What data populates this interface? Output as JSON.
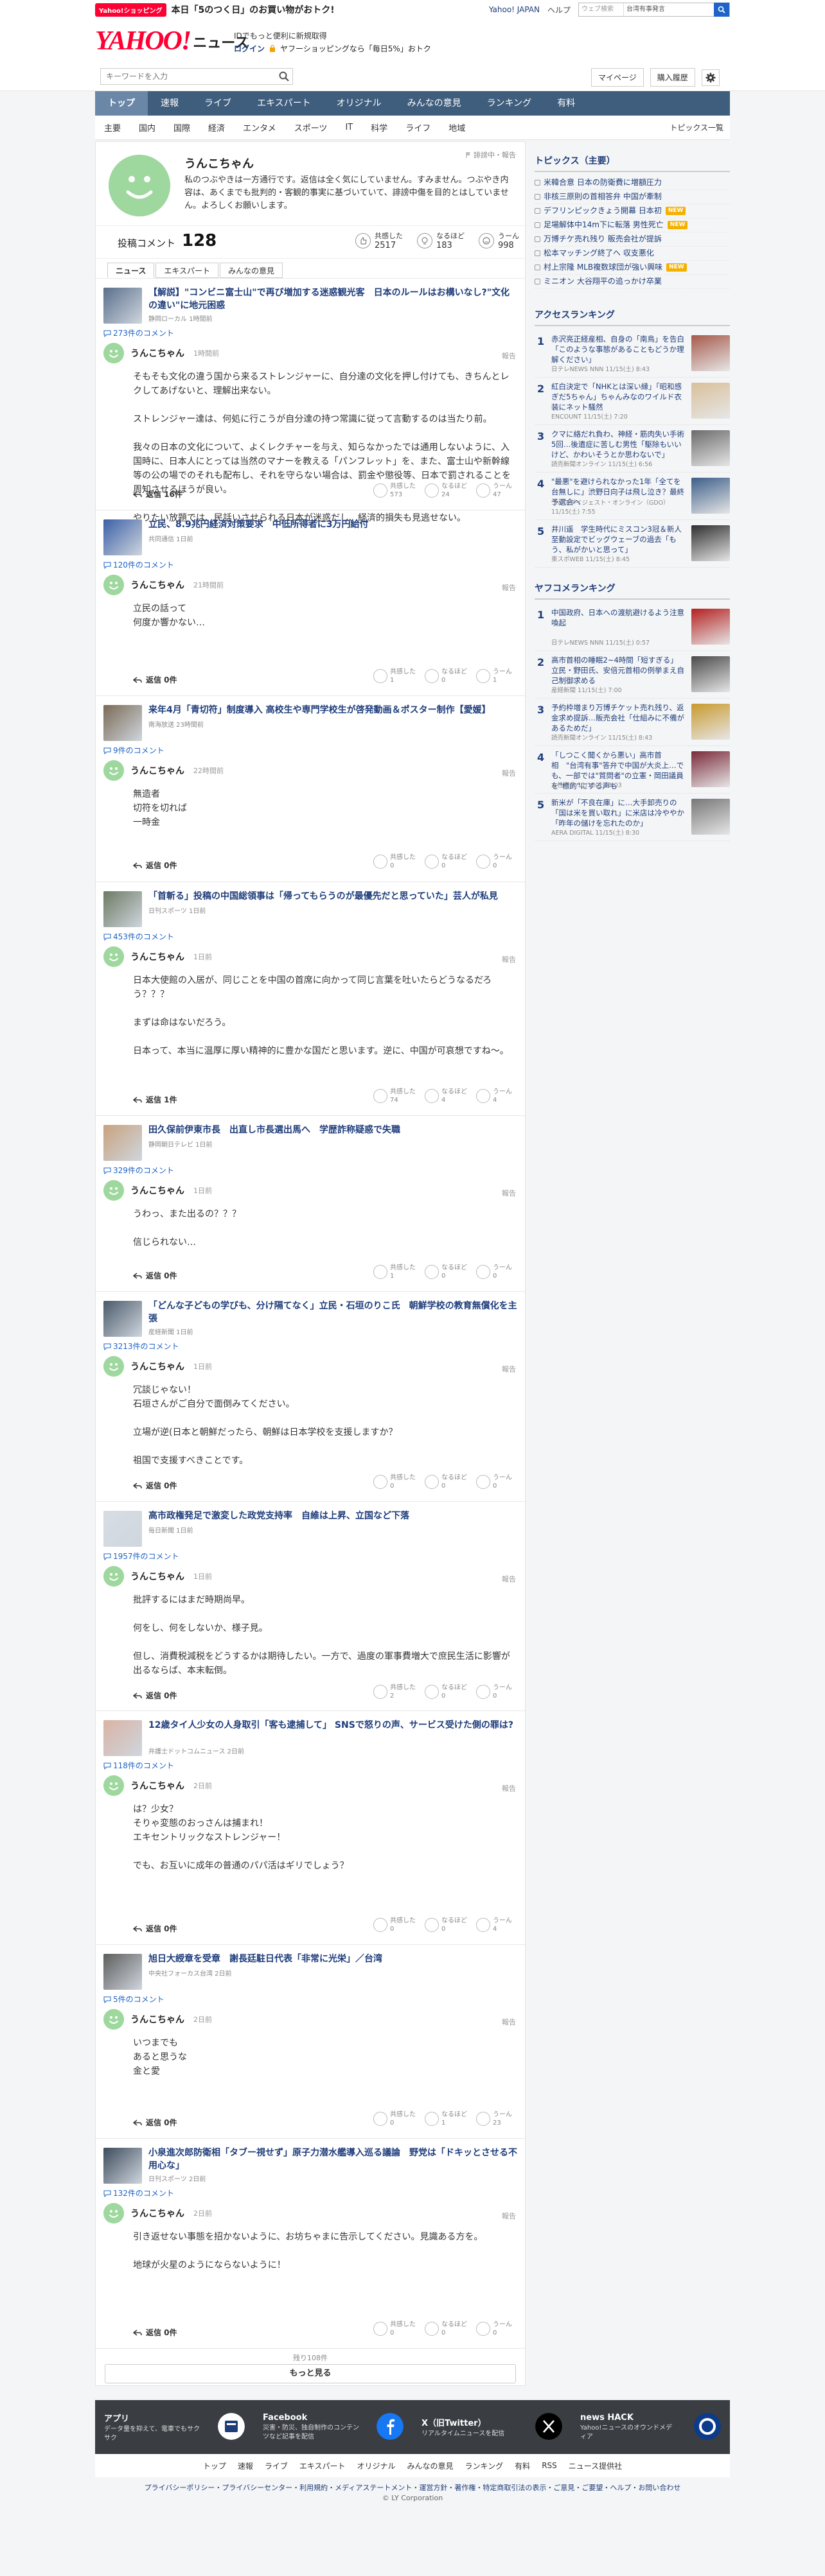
{
  "top": {
    "badge": "Yahoo!ショッピング",
    "promo": "本日「5のつく日」のお買い物がおトク!",
    "links": [
      "Yahoo! JAPAN",
      "ヘルプ"
    ],
    "search_scope": "ウェブ検索",
    "search_query": "台湾有事発言"
  },
  "header": {
    "logo_y": "YAHOO!",
    "logo_news": "ニュース",
    "id_line": "IDでもっと便利に新規取得",
    "login": "ログイン",
    "promo": "ヤフーショッピングなら「毎日5%」おトク"
  },
  "search": {
    "placeholder": "キーワードを入力",
    "mypage": "マイページ",
    "purchase": "購入履歴"
  },
  "nav": [
    "トップ",
    "速報",
    "ライブ",
    "エキスパート",
    "オリジナル",
    "みんなの意見",
    "ランキング",
    "有料"
  ],
  "subnav": [
    "主要",
    "国内",
    "国際",
    "経済",
    "エンタメ",
    "スポーツ",
    "IT",
    "科学",
    "ライフ",
    "地域"
  ],
  "subnav_all": "トピックス一覧",
  "profile": {
    "name": "うんこちゃん",
    "bio": "私のつぶやきは一方通行です。返信は全く気にしていません。すみません。つぶやき内容は、あくまでも批判的・客観的事実に基づいていて、誹謗中傷を目的とはしていません。よろしくお願いします。",
    "report": "誹謗中・報告",
    "posts_label": "投稿コメント",
    "posts_count": "128",
    "reacts": [
      {
        "label": "共感した",
        "value": "2517"
      },
      {
        "label": "なるほど",
        "value": "183"
      },
      {
        "label": "うーん",
        "value": "998"
      }
    ]
  },
  "tabs": [
    "ニュース",
    "エキスパート",
    "みんなの意見"
  ],
  "items": [
    {
      "title": "【解説】\"コンビニ富士山\"で再び増加する迷惑観光客　日本のルールはお構いなし?\"文化の違い\"に地元困惑",
      "source": "静岡ローカル 1時間前",
      "count": "273件のコメント",
      "name": "うんこちゃん",
      "time": "1時間前",
      "report": "報告",
      "body": [
        "そもそも文化の違う国から来るストレンジャーに、自分達の文化を押し付けても、きちんとレクしてあげないと、理解出来ない。",
        "ストレンジャー達は、何処に行こうが自分達の持つ常識に従って言動するのは当たり前。",
        "我々の日本の文化について、よくレクチャーを与え、知らなかったでは通用しないように、入国時に、日本人にとっては当然のマナーを教える「パンフレット」を、また、富士山や新幹線等の公の場でのそれも配布し、それを守らない場合は、罰金や懲役等、日本で罰されることを周知させるほうが良い。",
        "やりたい放題では、民話いさせられる日本が迷惑だし、経済的損失も見逃せない。"
      ],
      "reply": "返信 16件",
      "r": [
        "573",
        "24",
        "47"
      ]
    },
    {
      "title": "立民、8.9兆円経済対策要求　中低所得者に3万円給付",
      "source": "共同通信 1日前",
      "count": "120件のコメント",
      "name": "うんこちゃん",
      "time": "21時間前",
      "report": "報告",
      "body": [
        "立民の話って\n何度か響かない…"
      ],
      "reply": "返信 0件",
      "r": [
        "1",
        "0",
        "1"
      ]
    },
    {
      "title": "来年4月「青切符」制度導入 高校生や専門学校生が啓発動画＆ポスター制作【愛媛】",
      "source": "南海放送 23時間前",
      "count": "9件のコメント",
      "name": "うんこちゃん",
      "time": "22時間前",
      "report": "報告",
      "body": [
        "無造者\n切符を切れば\n一時金"
      ],
      "reply": "返信 0件",
      "r": [
        "0",
        "0",
        "0"
      ]
    },
    {
      "title": "「首斬る」投稿の中国総領事は「帰ってもらうのが最優先だと思っていた」芸人が私見",
      "source": "日刊スポーツ 1日前",
      "count": "453件のコメント",
      "name": "うんこちゃん",
      "time": "1日前",
      "report": "報告",
      "body": [
        "日本大使館の入居が、同じことを中国の首席に向かって同じ言葉を吐いたらどうなるだろう？？？",
        "まずは命はないだろう。",
        "日本って、本当に温厚に厚い精神的に豊かな国だと思います。逆に、中国が可哀想ですね〜。"
      ],
      "reply": "返信 1件",
      "r": [
        "74",
        "4",
        "4"
      ]
    },
    {
      "title": "田久保前伊東市長　出直し市長選出馬へ　学歴詐称疑惑で失職",
      "source": "静岡朝日テレビ 1日前",
      "count": "329件のコメント",
      "name": "うんこちゃん",
      "time": "1日前",
      "report": "報告",
      "body": [
        "うわっ、また出るの？？？",
        "信じられない…"
      ],
      "reply": "返信 0件",
      "r": [
        "1",
        "0",
        "0"
      ]
    },
    {
      "title": "「どんな子どもの学びも、分け隔てなく」立民・石垣のりこ氏　朝鮮学校の教育無償化を主張",
      "source": "産経新聞 1日前",
      "count": "3213件のコメント",
      "name": "うんこちゃん",
      "time": "1日前",
      "report": "報告",
      "body": [
        "冗談じゃない！\n石垣さんがご自分で面倒みてください。",
        "立場が逆(日本と朝鮮だったら、朝鮮は日本学校を支援しますか？",
        "祖国で支援すべきことです。"
      ],
      "reply": "返信 0件",
      "r": [
        "0",
        "0",
        "0"
      ]
    },
    {
      "title": "高市政権発足で激変した政党支持率　自維は上昇、立国など下落",
      "source": "毎日新聞 1日前",
      "count": "1957件のコメント",
      "name": "うんこちゃん",
      "time": "1日前",
      "report": "報告",
      "body": [
        "批評するにはまだ時期尚早。",
        "何をし、何をしないか、様子見。",
        "但し、消費税減税をどうするかは期待したい。一方で、過度の軍事費増大で庶民生活に影響が出るならば、本末転倒。"
      ],
      "reply": "返信 0件",
      "r": [
        "2",
        "0",
        "0"
      ]
    },
    {
      "title": "12歳タイ人少女の人身取引「客も逮捕して」 SNSで怒りの声、サービス受けた側の罪は?",
      "source": "弁護士ドットコムニュース 2日前",
      "count": "118件のコメント",
      "name": "うんこちゃん",
      "time": "2日前",
      "report": "報告",
      "body": [
        "は？少女？\nそりゃ変態のおっさんは捕まれ！\nエキセントリックなストレンジャー！",
        "でも、お互いに成年の普通のパパ活はギリでしょう？"
      ],
      "reply": "返信 0件",
      "r": [
        "0",
        "0",
        "4"
      ]
    },
    {
      "title": "旭日大綬章を受章　謝長廷駐日代表「非常に光栄」／台湾",
      "source": "中央社フォーカス台湾 2日前",
      "count": "5件のコメント",
      "name": "うんこちゃん",
      "time": "2日前",
      "report": "報告",
      "body": [
        "いつまでも\nあると思うな\n金と愛"
      ],
      "reply": "返信 0件",
      "r": [
        "0",
        "1",
        "23"
      ]
    },
    {
      "title": "小泉進次郎防衛相「タブー視せず」原子力潜水艦導入巡る議論　野党は「ドキッとさせる不用心な」",
      "source": "日刊スポーツ 2日前",
      "count": "132件のコメント",
      "name": "うんこちゃん",
      "time": "2日前",
      "report": "報告",
      "body": [
        "引き返せない事態を招かないように、お坊ちゃまに告示してください。見識ある方を。",
        "地球が火星のようにならないように！"
      ],
      "reply": "返信 0件",
      "r": [
        "0",
        "0",
        "0"
      ]
    }
  ],
  "remaining": "残り108件",
  "more": "もっと見る",
  "reaction_labels": [
    "共感した",
    "なるほど",
    "うーん"
  ],
  "topics_title": "トピックス（主要）",
  "topics": [
    {
      "text": "米韓合意 日本の防衛費に増額圧力",
      "new": ""
    },
    {
      "text": "非核三原則の首相答弁 中国が牽制",
      "new": ""
    },
    {
      "text": "デフリンピックきょう開幕 日本初",
      "new": "NEW"
    },
    {
      "text": "足場解体中14m下に転落 男性死亡",
      "new": "NEW"
    },
    {
      "text": "万博チケ売れ残り 販売会社が提訴",
      "new": ""
    },
    {
      "text": "松本マッチング終了へ 収支悪化",
      "new": ""
    },
    {
      "text": "村上宗隆 MLB複数球団が強い興味",
      "new": "NEW"
    },
    {
      "text": "ミニオン 大谷翔平の追っかけ卒業",
      "new": ""
    }
  ],
  "access_title": "アクセスランキング",
  "access": [
    {
      "title": "赤沢亮正経産相、自身の「南鳥」を告白「このような事態があることもどうか理解ください」",
      "src": "日テレNEWS NNN 11/15(土) 8:43"
    },
    {
      "title": "紅白決定で「NHKとは深い縁」「昭和感ぎだ5ちゃん」ちゃんみなのワイルド衣装にネット騒然",
      "src": "ENCOUNT 11/15(土) 7:20"
    },
    {
      "title": "クマに絡だれ負わ、神経・筋肉失い手術5回…後遺症に苦しむ男性「駆除もいいけど、かわいそうとか思わないで」",
      "src": "読売新聞オンライン 11/15(土) 6:56"
    },
    {
      "title": "\"最悪\"を避けられなかった1年「全てを台無しに」渋野日向子は飛し泣き？最終予選会へ",
      "src": "ゴルフダイジェスト・オンライン（GDO） 11/15(土) 7:55"
    },
    {
      "title": "井川遥　学生時代にミスコン3冠＆新人至動設定でビッグウェーブの過去「もう、私がかいと思って」",
      "src": "東スポWEB 11/15(土) 8:45"
    }
  ],
  "yafuko_title": "ヤフコメランキング",
  "yafuko": [
    {
      "title": "中国政府、日本への渡航避けるよう注意喚起",
      "src": "日テレNEWS NNN 11/15(土) 0:57"
    },
    {
      "title": "高市首相の睡眠2~4時間「短すぎる」立民・野田氏、安倍元首相の例挙まえ自己制御求める",
      "src": "産経新聞 11/15(土) 7:00"
    },
    {
      "title": "予約枠増まり万博チケット売れ残り、返金求め提訴…販売会社「仕組みに不備があるためだ」",
      "src": "読売新聞オンライン 11/15(土) 8:43"
    },
    {
      "title": "「しつこく聞くから悪い」高市首相　\"台湾有事\"答弁で中国が大炎上…でも、一部では\"質問者\"の立憲・岡田議員を\"標的\"にする声も",
      "src": "女性自身 11/15(土) 6:03"
    },
    {
      "title": "新米が「不良在庫」に…大手卸売りの「国は米を買い取れ」に米店は冷ややか「昨年の儲けを忘れたのか」",
      "src": "AERA DIGITAL 11/15(土) 8:30"
    }
  ],
  "sns": [
    {
      "title": "アプリ",
      "desc": "データ量を抑えて、電車でもサクサク"
    },
    {
      "title": "Facebook",
      "desc": "災害・防災、独自制作のコンテンツなど記事を配信"
    },
    {
      "title": "X（旧Twitter）",
      "desc": "リアルタイムニュースを配信"
    },
    {
      "title": "news HACK",
      "desc": "Yahoo!ニュースのオウンドメディア"
    }
  ],
  "footer_nav": [
    "トップ",
    "速報",
    "ライブ",
    "エキスパート",
    "オリジナル",
    "みんなの意見",
    "ランキング",
    "有料",
    "RSS",
    "ニュース提供社"
  ],
  "footer_links": "プライバシーポリシー・プライバシーセンター・利用規約・メディアステートメント・運営方針・著作権・特定商取引法の表示・ご意見・ご要望・ヘルプ・お問い合わせ",
  "copyright": "© LY Corporation",
  "colors": {
    "accent": "#1e63c7",
    "nav": "#3f5d7d",
    "brand": "#ff0033"
  }
}
